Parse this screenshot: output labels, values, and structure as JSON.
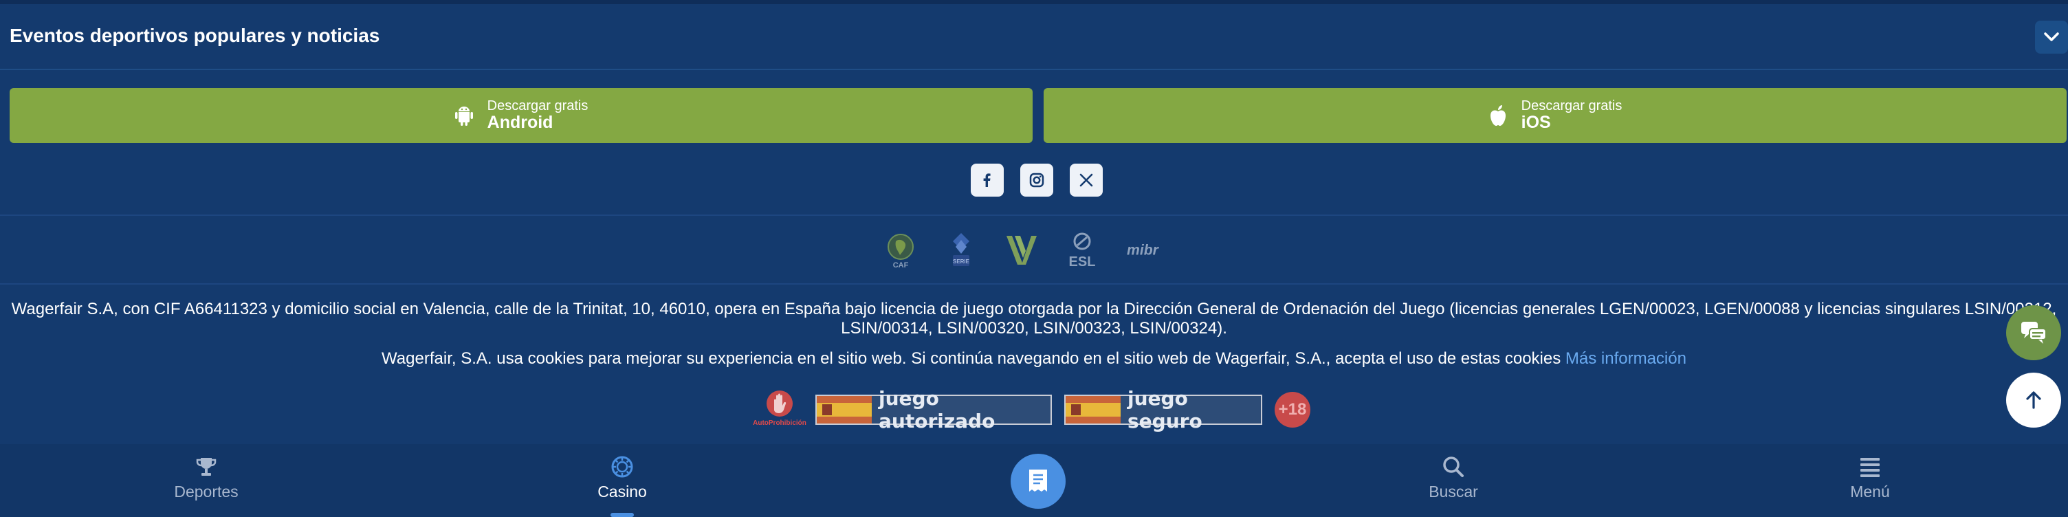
{
  "events": {
    "title": "Eventos deportivos populares y noticias",
    "toggle_icon": "chevron-down-icon"
  },
  "downloads": {
    "android": {
      "subtitle": "Descargar gratis",
      "title": "Android",
      "icon": "android-icon"
    },
    "ios": {
      "subtitle": "Descargar gratis",
      "title": "iOS",
      "icon": "apple-icon"
    }
  },
  "social": [
    "facebook-icon",
    "instagram-icon",
    "x-icon"
  ],
  "partners": [
    {
      "name": "CAF"
    },
    {
      "name": "Serie A"
    },
    {
      "name": "Volleyball"
    },
    {
      "name": "ESL"
    },
    {
      "name": "mibr"
    }
  ],
  "legal": {
    "text": "Wagerfair S.A, con CIF A66411323 y domicilio social en Valencia, calle de la Trinitat, 10, 46010, opera en España bajo licencia de juego otorgada por la Dirección General de Ordenación del Juego (licencias generales LGEN/00023, LGEN/00088 y licencias singulares LSIN/00212, LSIN/00314, LSIN/00320, LSIN/00323, LSIN/00324).",
    "cookies_text": "Wagerfair, S.A. usa cookies para mejorar su experiencia en el sitio web. Si continúa navegando en el sitio web de Wagerfair, S.A., acepta el uso de estas cookies",
    "more_link": "Más información"
  },
  "badges": {
    "autoprohibicion": "AutoProhibición",
    "juego_autorizado": "juego autorizado",
    "juego_seguro": "juego seguro",
    "age": "+18"
  },
  "nav": [
    {
      "label": "Deportes",
      "icon": "trophy-icon"
    },
    {
      "label": "Casino",
      "icon": "casino-chip-icon",
      "active": true
    },
    {
      "label": "",
      "icon": "betslip-icon"
    },
    {
      "label": "Buscar",
      "icon": "search-icon"
    },
    {
      "label": "Menú",
      "icon": "menu-icon"
    }
  ],
  "colors": {
    "background": "#143a6e",
    "download_button": "#84a843",
    "accent_blue": "#4a90e2",
    "chat_button": "#6e9448"
  }
}
